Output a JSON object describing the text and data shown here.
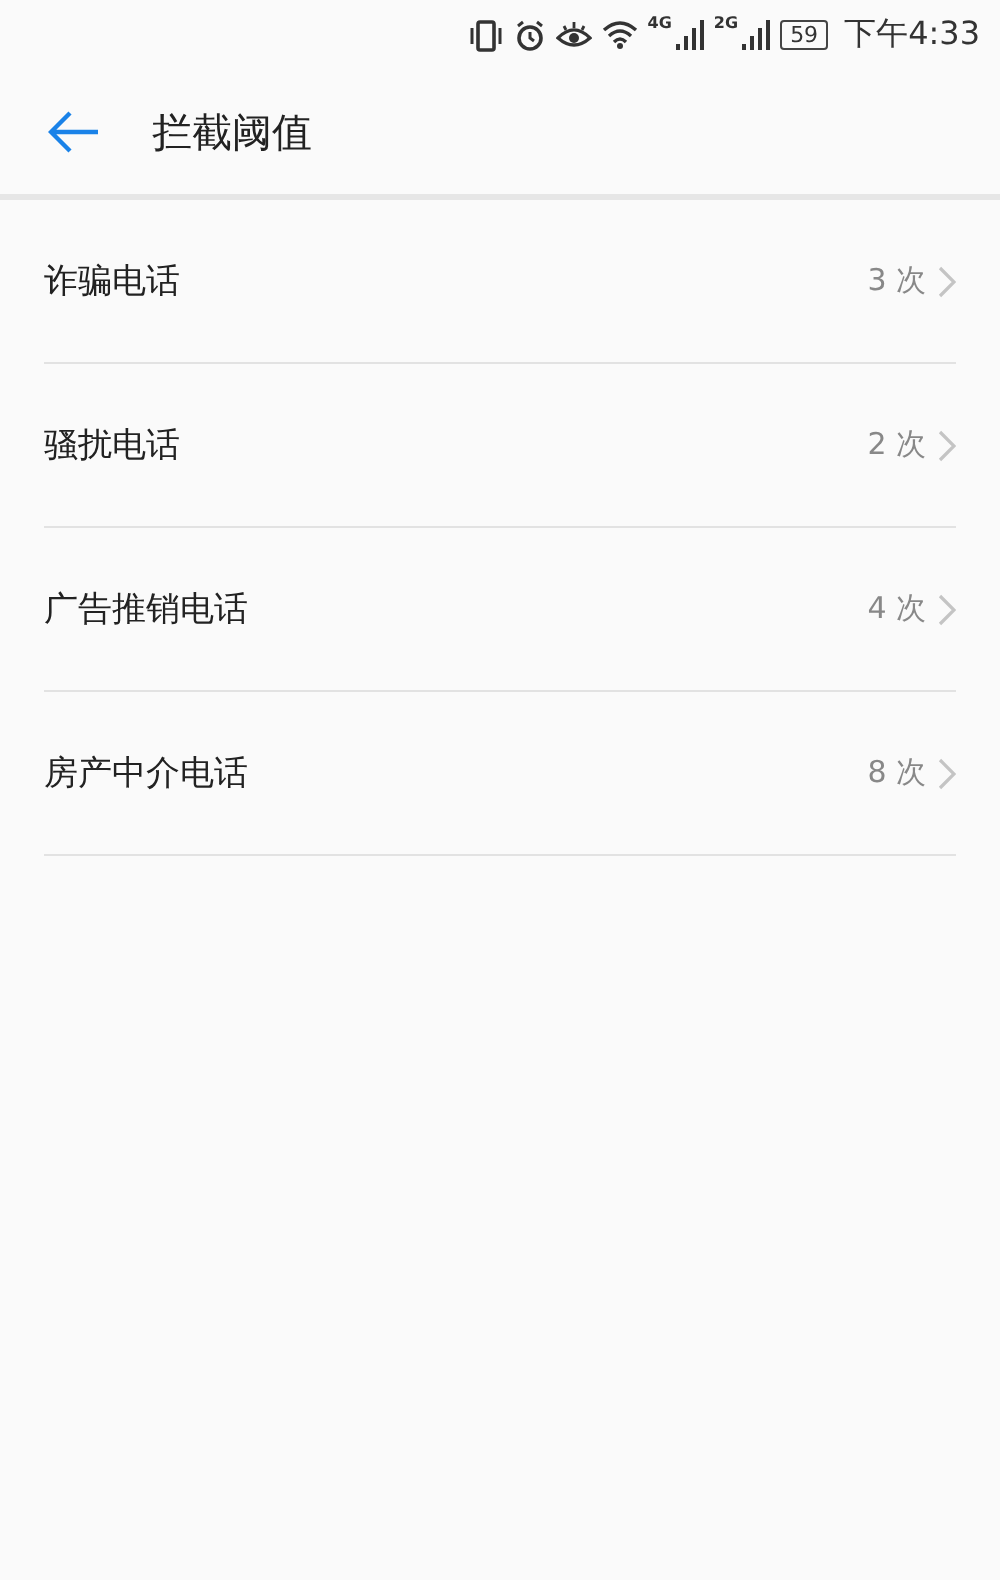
{
  "status_bar": {
    "network_1": "4G",
    "network_2": "2G",
    "battery": "59",
    "time": "下午4:33"
  },
  "header": {
    "title": "拦截阈值"
  },
  "items": [
    {
      "label": "诈骗电话",
      "value": "3 次"
    },
    {
      "label": "骚扰电话",
      "value": "2 次"
    },
    {
      "label": "广告推销电话",
      "value": "4 次"
    },
    {
      "label": "房产中介电话",
      "value": "8 次"
    }
  ]
}
